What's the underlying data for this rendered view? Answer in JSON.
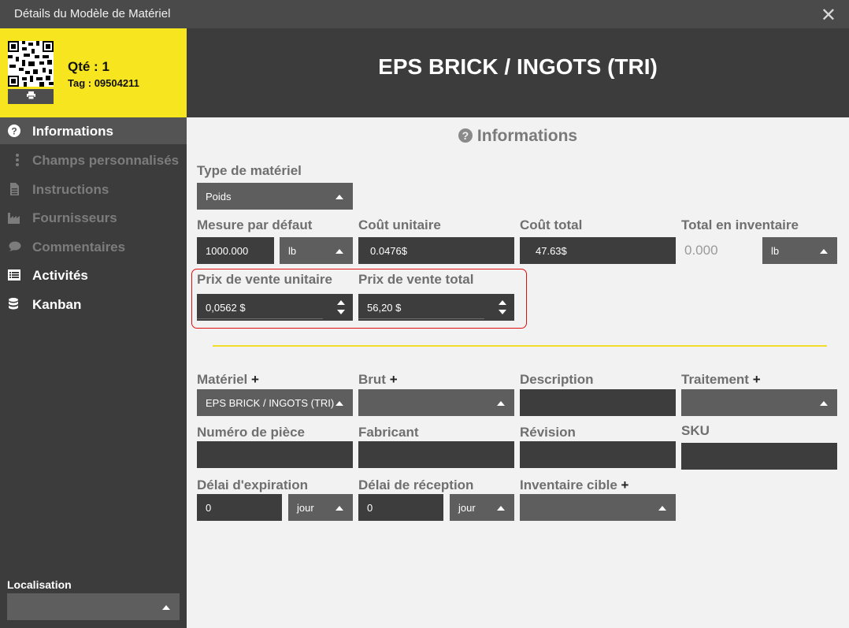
{
  "window": {
    "title": "Détails du Modèle de Matériel",
    "close_glyph": "✕"
  },
  "sidebar": {
    "qty": "Qté : 1",
    "tag": "Tag : 09504211",
    "print_icon": "printer-icon",
    "nav": [
      {
        "label": "Informations",
        "icon": "question-circle-icon"
      },
      {
        "label": "Champs personnalisés",
        "icon": "vertical-dots-icon"
      },
      {
        "label": "Instructions",
        "icon": "document-icon"
      },
      {
        "label": "Fournisseurs",
        "icon": "factory-icon"
      },
      {
        "label": "Commentaires",
        "icon": "speech-bubble-icon"
      },
      {
        "label": "Activités",
        "icon": "list-icon"
      },
      {
        "label": "Kanban",
        "icon": "database-icon"
      }
    ],
    "location": {
      "label": "Localisation",
      "value": ""
    }
  },
  "header": {
    "name": "EPS BRICK / INGOTS (TRI)"
  },
  "section": {
    "title": "Informations",
    "icon": "question-circle-icon"
  },
  "fields": {
    "type": {
      "label": "Type de matériel",
      "value": "Poids"
    },
    "measure": {
      "label": "Mesure par défaut",
      "value": "1000.000",
      "unit": "lb"
    },
    "unit_cost": {
      "label": "Coût unitaire",
      "value": "0.0476$"
    },
    "total_cost": {
      "label": "Coût total",
      "value": "47.63$"
    },
    "inventory": {
      "label": "Total en inventaire",
      "value": "0.000",
      "unit": "lb"
    },
    "unit_price": {
      "label": "Prix de vente unitaire",
      "value": "0,0562 $"
    },
    "total_price": {
      "label": "Prix de vente total",
      "value": "56,20 $"
    },
    "material": {
      "label": "Matériel",
      "plus": "+",
      "value": "EPS BRICK / INGOTS (TRI)"
    },
    "raw": {
      "label": "Brut",
      "plus": "+",
      "value": ""
    },
    "description": {
      "label": "Description",
      "value": ""
    },
    "treatment": {
      "label": "Traitement",
      "plus": "+",
      "value": ""
    },
    "part_number": {
      "label": "Numéro de pièce",
      "value": ""
    },
    "manufacturer": {
      "label": "Fabricant",
      "value": ""
    },
    "revision": {
      "label": "Révision",
      "value": ""
    },
    "sku": {
      "label": "SKU",
      "value": ""
    },
    "expiry": {
      "label": "Délai d'expiration",
      "value": "0",
      "unit": "jour"
    },
    "reception": {
      "label": "Délai de réception",
      "value": "0",
      "unit": "jour"
    },
    "target_inventory": {
      "label": "Inventaire cible",
      "plus": "+",
      "value": ""
    }
  },
  "colors": {
    "accent_yellow": "#f7e51f",
    "highlight_red": "#e01010",
    "dark": "#3c3c3c"
  }
}
